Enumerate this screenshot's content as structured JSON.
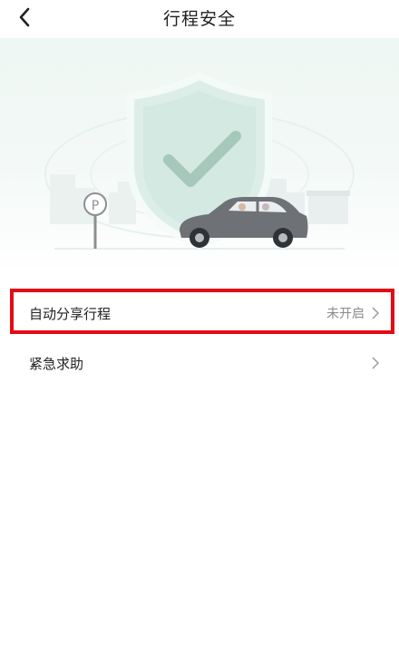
{
  "header": {
    "title": "行程安全",
    "back_icon": "chevron-left-icon"
  },
  "hero": {
    "parking_sign": "P",
    "illustration": [
      "shield-check-icon",
      "car-icon",
      "parking-sign-icon"
    ]
  },
  "menu": {
    "items": [
      {
        "label": "自动分享行程",
        "value": "未开启",
        "icon": "chevron-right-icon"
      },
      {
        "label": "紧急求助",
        "value": "",
        "icon": "chevron-right-icon"
      }
    ]
  },
  "colors": {
    "highlight": "#e30b14",
    "shield": "#d9ece5",
    "check": "#a5c8bb",
    "car": "#6e7176"
  }
}
